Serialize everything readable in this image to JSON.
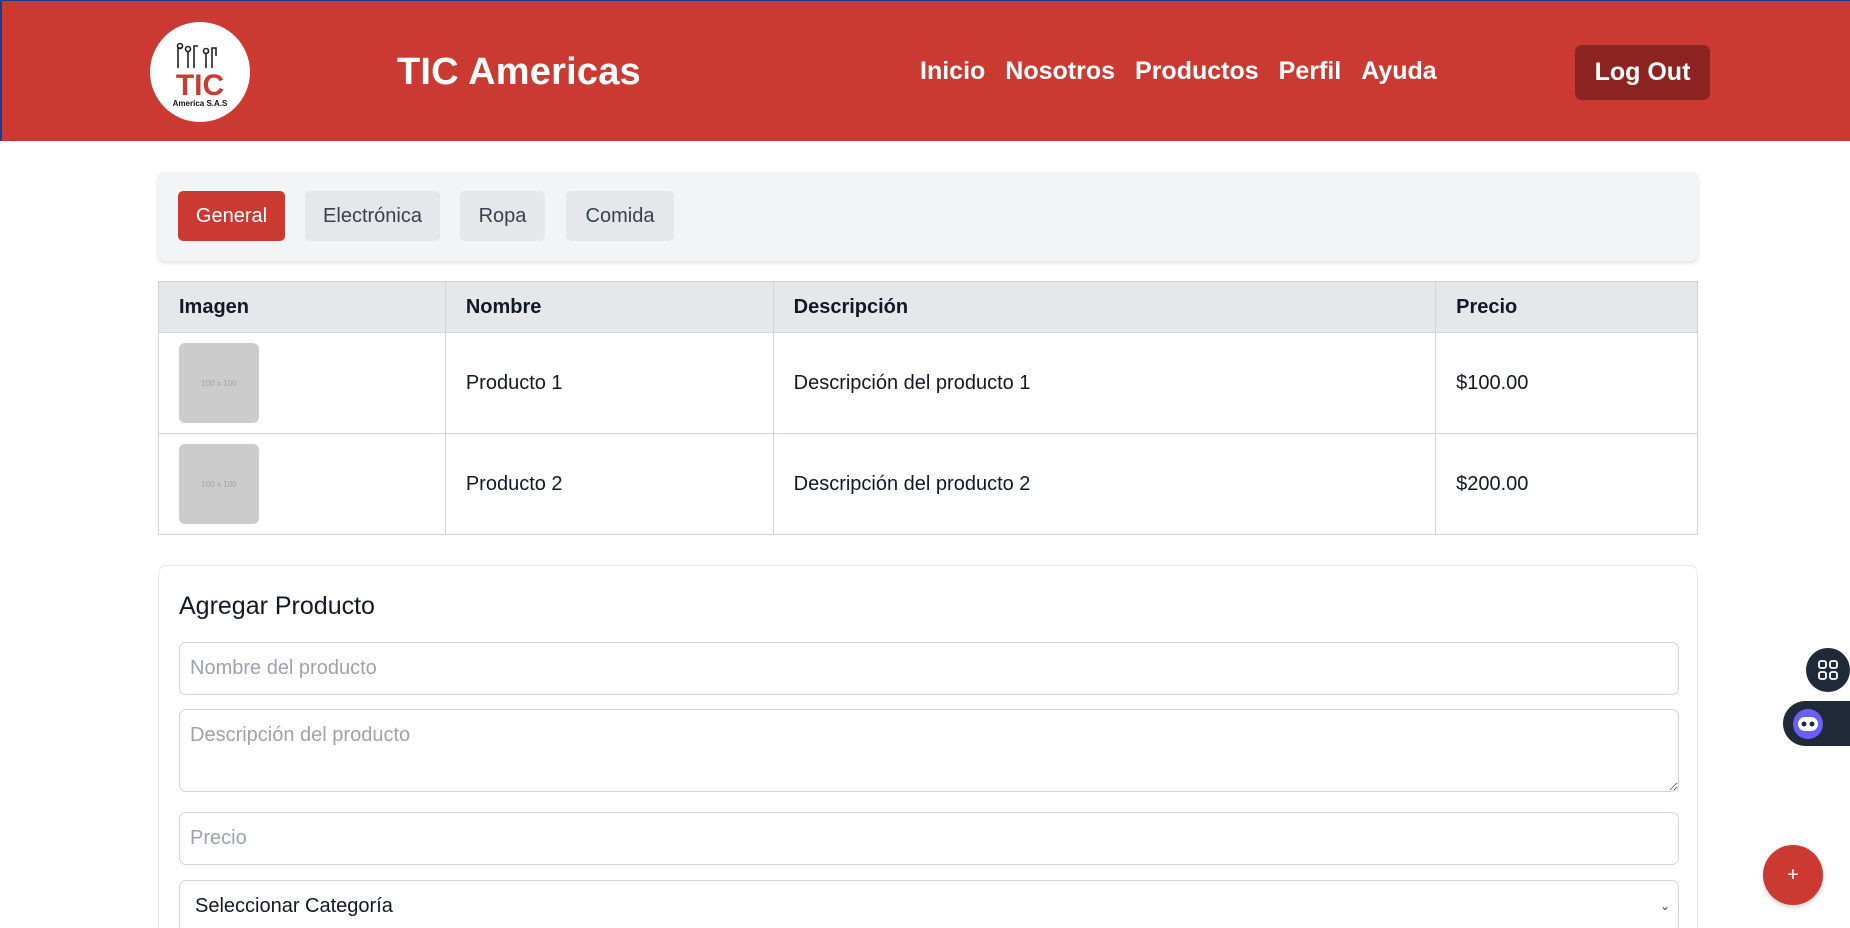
{
  "header": {
    "logo_text": "TIC",
    "logo_subtext": "America S.A.S",
    "brand": "TIC Americas",
    "nav": [
      "Inicio",
      "Nosotros",
      "Productos",
      "Perfil",
      "Ayuda"
    ],
    "logout_label": "Log Out"
  },
  "tabs": [
    "General",
    "Electrónica",
    "Ropa",
    "Comida"
  ],
  "active_tab": "General",
  "table": {
    "headers": [
      "Imagen",
      "Nombre",
      "Descripción",
      "Precio"
    ],
    "rows": [
      {
        "image_text": "100 x 100",
        "name": "Producto 1",
        "description": "Descripción del producto 1",
        "price": "$100.00"
      },
      {
        "image_text": "100 x 100",
        "name": "Producto 2",
        "description": "Descripción del producto 2",
        "price": "$200.00"
      }
    ]
  },
  "form": {
    "title": "Agregar Producto",
    "name_placeholder": "Nombre del producto",
    "description_placeholder": "Descripción del producto",
    "price_placeholder": "Precio",
    "category_selected": "Seleccionar Categoría"
  },
  "fab_label": "+",
  "colors": {
    "primary": "#cb3a32",
    "primary_dark": "#8b2420",
    "tab_bg": "#e5e7eb"
  }
}
